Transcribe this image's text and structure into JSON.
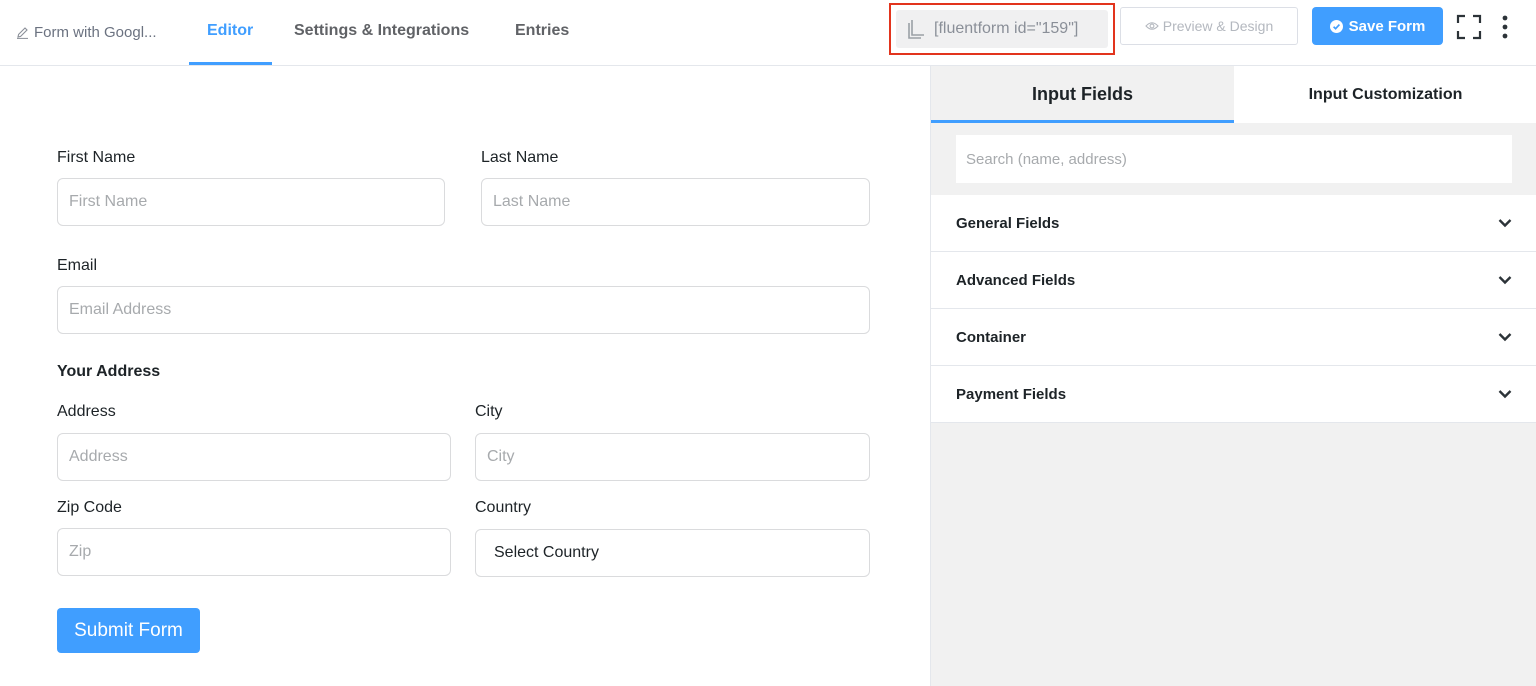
{
  "header": {
    "form_title": "Form with Googl...",
    "tabs": [
      {
        "label": "Editor",
        "active": true
      },
      {
        "label": "Settings & Integrations",
        "active": false
      },
      {
        "label": "Entries",
        "active": false
      }
    ],
    "shortcode": "[fluentform id=\"159\"]",
    "preview_label": "Preview & Design",
    "save_label": "Save Form"
  },
  "form": {
    "first_name": {
      "label": "First Name",
      "placeholder": "First Name"
    },
    "last_name": {
      "label": "Last Name",
      "placeholder": "Last Name"
    },
    "email": {
      "label": "Email",
      "placeholder": "Email Address"
    },
    "address_section_title": "Your Address",
    "address": {
      "label": "Address",
      "placeholder": "Address"
    },
    "city": {
      "label": "City",
      "placeholder": "City"
    },
    "zip": {
      "label": "Zip Code",
      "placeholder": "Zip"
    },
    "country": {
      "label": "Country",
      "value": "Select Country"
    },
    "submit_label": "Submit Form"
  },
  "panel": {
    "tabs": [
      {
        "label": "Input Fields",
        "active": true
      },
      {
        "label": "Input Customization",
        "active": false
      }
    ],
    "search_placeholder": "Search (name, address)",
    "sections": [
      {
        "label": "General Fields"
      },
      {
        "label": "Advanced Fields"
      },
      {
        "label": "Container"
      },
      {
        "label": "Payment Fields"
      }
    ]
  },
  "colors": {
    "accent": "#409eff",
    "highlight_border": "#e2341d"
  },
  "icons": {
    "crumb": "pencil-icon",
    "shortcode": "copy-icon",
    "preview": "eye-icon",
    "save": "check-circle-icon",
    "fullscreen": "fullscreen-icon",
    "more": "kebab-menu-icon",
    "accordion": "chevron-down-icon"
  }
}
